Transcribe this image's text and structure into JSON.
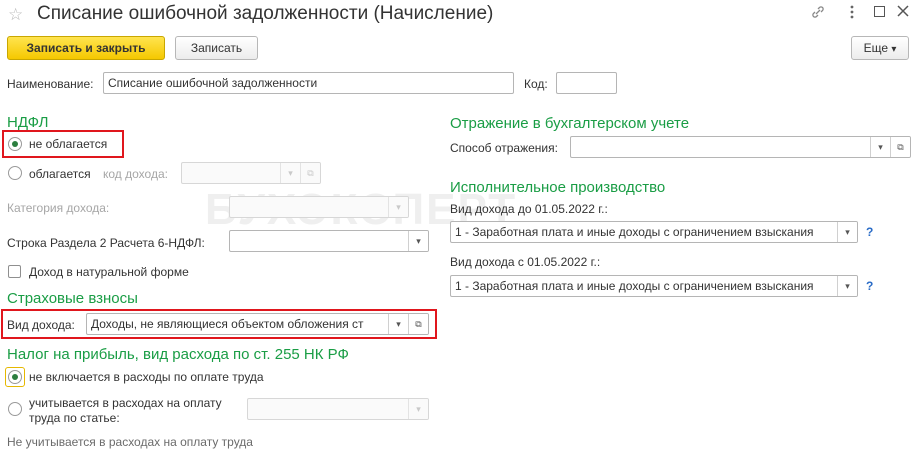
{
  "window": {
    "title": "Списание ошибочной задолженности (Начисление)",
    "icons": [
      "star-icon",
      "back-arrow-icon",
      "forward-arrow-icon",
      "link-icon",
      "more-icon",
      "maximize-icon",
      "close-icon"
    ]
  },
  "toolbar": {
    "save_close_label": "Записать и закрыть",
    "save_label": "Записать",
    "more_label": "Еще",
    "more_arrow": "▾"
  },
  "form": {
    "name_label": "Наименование:",
    "name_value": "Списание ошибочной задолженности",
    "code_label": "Код:",
    "code_value": ""
  },
  "ndfl": {
    "heading": "НДФЛ",
    "not_taxed_label": "не облагается",
    "taxed_label": "облагается",
    "income_code_label": "код дохода:",
    "income_code_value": "",
    "income_category_label": "Категория дохода:",
    "income_category_value": "",
    "section2_label": "Строка Раздела 2 Расчета 6-НДФЛ:",
    "section2_value": "",
    "in_kind_label": "Доход в натуральной форме"
  },
  "insurance": {
    "heading": "Страховые взносы",
    "income_type_label": "Вид дохода:",
    "income_type_value": "Доходы, не являющиеся объектом обложения ст"
  },
  "profit_tax": {
    "heading": "Налог на прибыль, вид расхода по ст. 255 НК РФ",
    "not_included_label": "не включается в расходы по оплате труда",
    "included_label_line1": "учитывается в расходах на оплату",
    "included_label_line2": "труда по статье:",
    "article_value": "",
    "note": "Не учитывается в расходах на оплату труда"
  },
  "accounting": {
    "heading": "Отражение в бухгалтерском учете",
    "method_label": "Способ отражения:",
    "method_value": ""
  },
  "enforcement": {
    "heading": "Исполнительное производство",
    "before_label": "Вид дохода до 01.05.2022 г.:",
    "before_value": "1 - Заработная плата и иные доходы с ограничением взыскания",
    "after_label": "Вид дохода с 01.05.2022 г.:",
    "after_value": "1 - Заработная плата и иные доходы с ограничением взыскания",
    "help_mark": "?"
  },
  "glyphs": {
    "dropdown": "▾",
    "open": "⧉"
  },
  "watermark": "БУХЭКСПЕРТ",
  "colors": {
    "accent_green": "#1a9d45",
    "primary_button": "#f5c800",
    "highlight_red": "#e0161d",
    "help_blue": "#2a6cc7"
  }
}
